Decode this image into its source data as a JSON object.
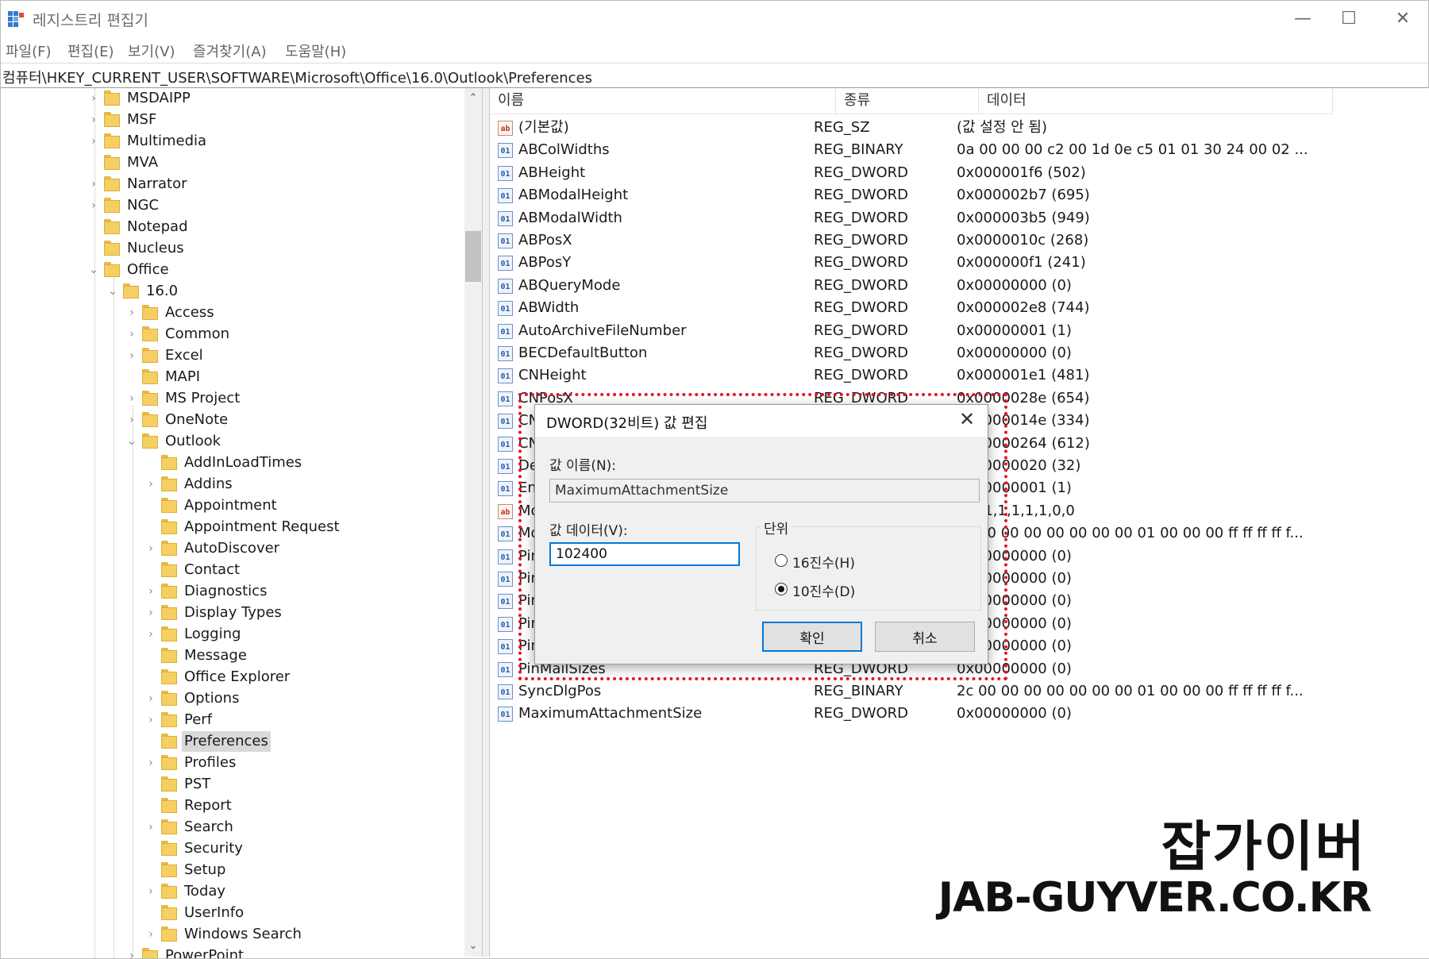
{
  "window": {
    "title": "레지스트리 편집기",
    "min": "—",
    "max": "☐",
    "close": "✕"
  },
  "menu": [
    "파일(F)",
    "편집(E)",
    "보기(V)",
    "즐겨찾기(A)",
    "도움말(H)"
  ],
  "address": "컴퓨터\\HKEY_CURRENT_USER\\SOFTWARE\\Microsoft\\Office\\16.0\\Outlook\\Preferences",
  "tree": [
    {
      "label": "MSDAIPP",
      "depth": 0,
      "exp": "›"
    },
    {
      "label": "MSF",
      "depth": 0,
      "exp": "›"
    },
    {
      "label": "Multimedia",
      "depth": 0,
      "exp": "›"
    },
    {
      "label": "MVA",
      "depth": 0,
      "exp": ""
    },
    {
      "label": "Narrator",
      "depth": 0,
      "exp": "›"
    },
    {
      "label": "NGC",
      "depth": 0,
      "exp": "›"
    },
    {
      "label": "Notepad",
      "depth": 0,
      "exp": ""
    },
    {
      "label": "Nucleus",
      "depth": 0,
      "exp": ""
    },
    {
      "label": "Office",
      "depth": 0,
      "exp": "⌄"
    },
    {
      "label": "16.0",
      "depth": 1,
      "exp": "⌄"
    },
    {
      "label": "Access",
      "depth": 2,
      "exp": "›"
    },
    {
      "label": "Common",
      "depth": 2,
      "exp": "›"
    },
    {
      "label": "Excel",
      "depth": 2,
      "exp": "›"
    },
    {
      "label": "MAPI",
      "depth": 2,
      "exp": ""
    },
    {
      "label": "MS Project",
      "depth": 2,
      "exp": "›"
    },
    {
      "label": "OneNote",
      "depth": 2,
      "exp": "›"
    },
    {
      "label": "Outlook",
      "depth": 2,
      "exp": "⌄"
    },
    {
      "label": "AddInLoadTimes",
      "depth": 3,
      "exp": ""
    },
    {
      "label": "Addins",
      "depth": 3,
      "exp": "›"
    },
    {
      "label": "Appointment",
      "depth": 3,
      "exp": ""
    },
    {
      "label": "Appointment Request",
      "depth": 3,
      "exp": ""
    },
    {
      "label": "AutoDiscover",
      "depth": 3,
      "exp": "›"
    },
    {
      "label": "Contact",
      "depth": 3,
      "exp": ""
    },
    {
      "label": "Diagnostics",
      "depth": 3,
      "exp": "›"
    },
    {
      "label": "Display Types",
      "depth": 3,
      "exp": "›"
    },
    {
      "label": "Logging",
      "depth": 3,
      "exp": "›"
    },
    {
      "label": "Message",
      "depth": 3,
      "exp": ""
    },
    {
      "label": "Office Explorer",
      "depth": 3,
      "exp": ""
    },
    {
      "label": "Options",
      "depth": 3,
      "exp": "›"
    },
    {
      "label": "Perf",
      "depth": 3,
      "exp": "›"
    },
    {
      "label": "Preferences",
      "depth": 3,
      "exp": "",
      "selected": true
    },
    {
      "label": "Profiles",
      "depth": 3,
      "exp": "›"
    },
    {
      "label": "PST",
      "depth": 3,
      "exp": ""
    },
    {
      "label": "Report",
      "depth": 3,
      "exp": ""
    },
    {
      "label": "Search",
      "depth": 3,
      "exp": "›"
    },
    {
      "label": "Security",
      "depth": 3,
      "exp": ""
    },
    {
      "label": "Setup",
      "depth": 3,
      "exp": ""
    },
    {
      "label": "Today",
      "depth": 3,
      "exp": "›"
    },
    {
      "label": "UserInfo",
      "depth": 3,
      "exp": ""
    },
    {
      "label": "Windows Search",
      "depth": 3,
      "exp": "›"
    },
    {
      "label": "PowerPoint",
      "depth": 2,
      "exp": "›"
    }
  ],
  "list": {
    "headers": [
      "이름",
      "종류",
      "데이터"
    ],
    "rows": [
      {
        "icon": "sz",
        "name": "(기본값)",
        "type": "REG_SZ",
        "data": "(값 설정 안 됨)"
      },
      {
        "icon": "bin",
        "name": "ABColWidths",
        "type": "REG_BINARY",
        "data": "0a 00 00 00 c2 00 1d 0e c5 01 01 30 24 00 02 ..."
      },
      {
        "icon": "bin",
        "name": "ABHeight",
        "type": "REG_DWORD",
        "data": "0x000001f6 (502)"
      },
      {
        "icon": "bin",
        "name": "ABModalHeight",
        "type": "REG_DWORD",
        "data": "0x000002b7 (695)"
      },
      {
        "icon": "bin",
        "name": "ABModalWidth",
        "type": "REG_DWORD",
        "data": "0x000003b5 (949)"
      },
      {
        "icon": "bin",
        "name": "ABPosX",
        "type": "REG_DWORD",
        "data": "0x0000010c (268)"
      },
      {
        "icon": "bin",
        "name": "ABPosY",
        "type": "REG_DWORD",
        "data": "0x000000f1 (241)"
      },
      {
        "icon": "bin",
        "name": "ABQueryMode",
        "type": "REG_DWORD",
        "data": "0x00000000 (0)"
      },
      {
        "icon": "bin",
        "name": "ABWidth",
        "type": "REG_DWORD",
        "data": "0x000002e8 (744)"
      },
      {
        "icon": "bin",
        "name": "AutoArchiveFileNumber",
        "type": "REG_DWORD",
        "data": "0x00000001 (1)"
      },
      {
        "icon": "bin",
        "name": "BECDefaultButton",
        "type": "REG_DWORD",
        "data": "0x00000000 (0)"
      },
      {
        "icon": "bin",
        "name": "CNHeight",
        "type": "REG_DWORD",
        "data": "0x000001e1 (481)"
      },
      {
        "icon": "bin",
        "name": "CNPosX",
        "type": "REG_DWORD",
        "data": "0x0000028e (654)"
      },
      {
        "icon": "bin",
        "name": "CN",
        "type": "",
        "data": "0x0000014e (334)"
      },
      {
        "icon": "bin",
        "name": "CN",
        "type": "",
        "data": "0x00000264 (612)"
      },
      {
        "icon": "bin",
        "name": "De",
        "type": "",
        "data": "0x00000020 (32)"
      },
      {
        "icon": "bin",
        "name": "En",
        "type": "",
        "data": "0x00000001 (1)"
      },
      {
        "icon": "sz",
        "name": "Mo",
        "type": "",
        "data": "1,1,1,1,1,1,1,0,0"
      },
      {
        "icon": "bin",
        "name": "Mo",
        "type": "",
        "data": "2c 00 00 00 00 00 00 00 01 00 00 00 ff ff ff ff f..."
      },
      {
        "icon": "bin",
        "name": "Pin",
        "type": "",
        "data": "0x00000000 (0)"
      },
      {
        "icon": "bin",
        "name": "Pin",
        "type": "",
        "data": "0x00000000 (0)"
      },
      {
        "icon": "bin",
        "name": "Pin",
        "type": "",
        "data": "0x00000000 (0)"
      },
      {
        "icon": "bin",
        "name": "Pin",
        "type": "",
        "data": "0x00000000 (0)"
      },
      {
        "icon": "bin",
        "name": "Pin",
        "type": "",
        "data": "0x00000000 (0)"
      },
      {
        "icon": "bin",
        "name": "PinMailSizes",
        "type": "REG_DWORD",
        "data": "0x00000000 (0)"
      },
      {
        "icon": "bin",
        "name": "SyncDlgPos",
        "type": "REG_BINARY",
        "data": "2c 00 00 00 00 00 00 00 01 00 00 00 ff ff ff ff f..."
      },
      {
        "icon": "bin",
        "name": "MaximumAttachmentSize",
        "type": "REG_DWORD",
        "data": "0x00000000 (0)"
      }
    ]
  },
  "dialog": {
    "title": "DWORD(32비트) 값 편집",
    "close": "✕",
    "name_label": "값 이름(N):",
    "name_value": "MaximumAttachmentSize",
    "data_label": "값 데이터(V):",
    "data_value": "102400",
    "base_label": "단위",
    "hex_label": "16진수(H)",
    "dec_label": "10진수(D)",
    "selected_base": "dec",
    "ok": "확인",
    "cancel": "취소"
  },
  "watermark": {
    "korean": "잡가이버",
    "domain": "JAB-GUYVER.CO.KR"
  },
  "colors": {
    "accent": "#0078d7",
    "highlight": "#e3162b",
    "folder": "#f5cf61",
    "selection": "#d9d9d9"
  }
}
